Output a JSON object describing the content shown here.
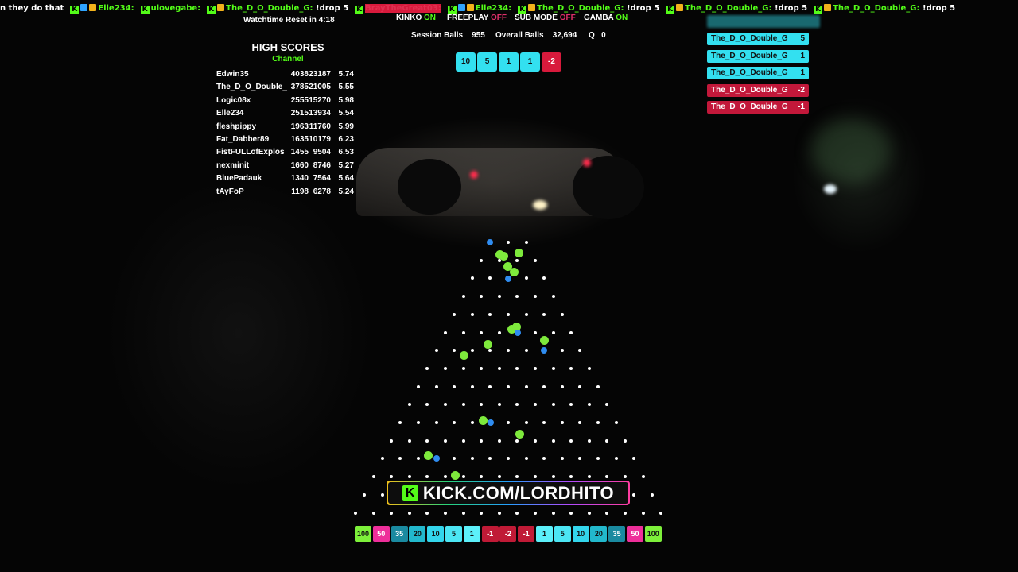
{
  "ticker": [
    {
      "msg": "n they do that"
    },
    {
      "badges": [
        "k",
        "blue",
        "gold"
      ],
      "user": "Elle234:",
      "msg": ""
    },
    {
      "badges": [
        "k"
      ],
      "user": "ulovegabe:",
      "msg": ""
    },
    {
      "badges": [
        "k",
        "gold"
      ],
      "user": "The_D_O_Double_G:",
      "msg": "!drop 5"
    },
    {
      "badges": [
        "k"
      ],
      "user": "BrayTheGreat03:",
      "user_color": "red",
      "msg": ""
    },
    {
      "badges": [
        "k",
        "blue",
        "gold"
      ],
      "user": "Elle234:",
      "msg": ""
    },
    {
      "badges": [
        "k",
        "gold"
      ],
      "user": "The_D_O_Double_G:",
      "msg": "!drop 5"
    },
    {
      "badges": [
        "k",
        "gold"
      ],
      "user": "The_D_O_Double_G:",
      "msg": "!drop 5"
    },
    {
      "badges": [
        "k",
        "gold"
      ],
      "user": "The_D_O_Double_G:",
      "msg": "!drop 5"
    }
  ],
  "watchtime": "Watchtime Reset in 4:18",
  "modes": {
    "kinko_label": "KINKO",
    "kinko_state": "ON",
    "freeplay_label": "FREEPLAY",
    "freeplay_state": "OFF",
    "submode_label": "SUB MODE",
    "submode_state": "OFF",
    "gamba_label": "GAMBA",
    "gamba_state": "ON"
  },
  "session": {
    "session_label": "Session Balls",
    "session_value": "955",
    "overall_label": "Overall Balls",
    "overall_value": "32,694",
    "q_label": "Q",
    "q_value": "0"
  },
  "recent_results": [
    "10",
    "5",
    "1",
    "1",
    "-2"
  ],
  "high_scores": {
    "title": "HIGH SCORES",
    "subtitle": "Channel",
    "rows": [
      {
        "name": "Edwin35",
        "a": "4038",
        "b": "23187",
        "c": "5.74"
      },
      {
        "name": "The_D_O_Double_",
        "a": "3785",
        "b": "21005",
        "c": "5.55"
      },
      {
        "name": "Logic08x",
        "a": "2555",
        "b": "15270",
        "c": "5.98"
      },
      {
        "name": "Elle234",
        "a": "2515",
        "b": "13934",
        "c": "5.54"
      },
      {
        "name": "fleshpippy",
        "a": "1963",
        "b": "11760",
        "c": "5.99"
      },
      {
        "name": "Fat_Dabber89",
        "a": "1635",
        "b": "10179",
        "c": "6.23"
      },
      {
        "name": "FistFULLofExplos",
        "a": "1455",
        "b": "9504",
        "c": "6.53"
      },
      {
        "name": "nexminit",
        "a": "1660",
        "b": "8746",
        "c": "5.27"
      },
      {
        "name": "BluePadauk",
        "a": "1340",
        "b": "7564",
        "c": "5.64"
      },
      {
        "name": "tAyFoP",
        "a": "1198",
        "b": "6278",
        "c": "5.24"
      }
    ]
  },
  "drops": [
    {
      "user": "The_D_O_Double_G",
      "value": "5",
      "color": "cyan"
    },
    {
      "user": "The_D_O_Double_G",
      "value": "1",
      "color": "cyan"
    },
    {
      "user": "The_D_O_Double_G",
      "value": "1",
      "color": "cyan"
    },
    {
      "user": "The_D_O_Double_G",
      "value": "-2",
      "color": "red"
    },
    {
      "user": "The_D_O_Double_G",
      "value": "-1",
      "color": "red"
    }
  ],
  "slots": [
    "100",
    "50",
    "35",
    "20",
    "10",
    "5",
    "1",
    "-1",
    "-2",
    "-1",
    "1",
    "5",
    "10",
    "20",
    "35",
    "50",
    "100"
  ],
  "slot_colors": {
    "100": "#7df03a",
    "50": "#ee2f9a",
    "35": "#1a8aa0",
    "20": "#22b8cc",
    "10": "#33d6ec",
    "5": "#4ce6f4",
    "1": "#5cf0fa",
    "-1": "#c01a36",
    "-2": "#c01a36"
  },
  "banner_text": "KICK.COM/LORDHITO",
  "banner_logo": "K"
}
